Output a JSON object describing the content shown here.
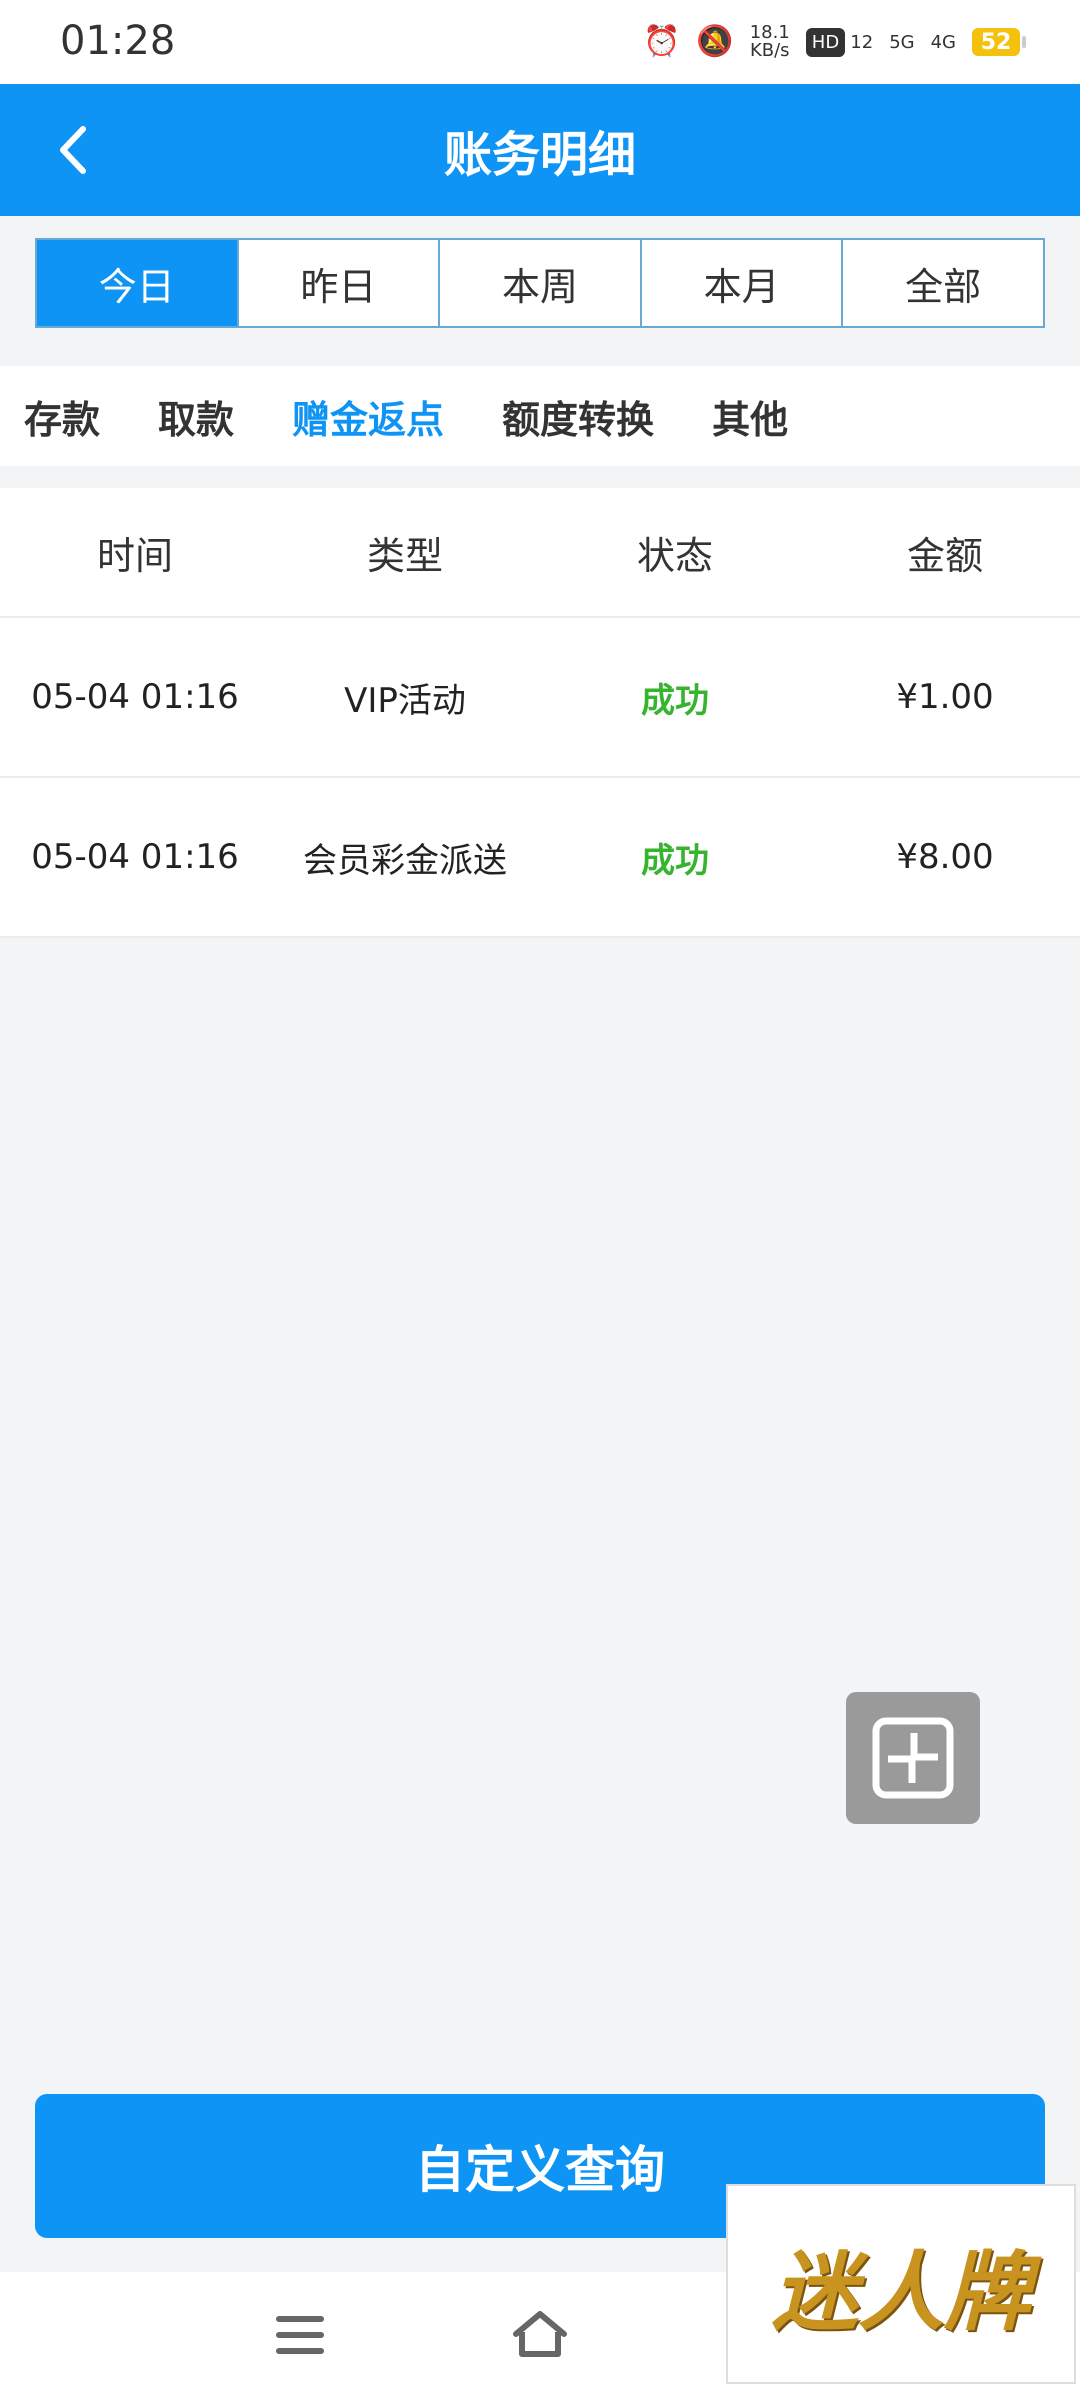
{
  "status_bar": {
    "time": "01:28",
    "net_speed_value": "18.1",
    "net_speed_unit": "KB/s",
    "hd_label": "HD",
    "sim1": "1",
    "sim2": "2",
    "sig_5g": "5G",
    "sig_4g": "4G",
    "battery": "52"
  },
  "header": {
    "title": "账务明细"
  },
  "date_tabs": [
    "今日",
    "昨日",
    "本周",
    "本月",
    "全部"
  ],
  "date_tabs_active": 0,
  "categories": [
    "存款",
    "取款",
    "赠金返点",
    "额度转换",
    "其他"
  ],
  "categories_active": 2,
  "table": {
    "headers": [
      "时间",
      "类型",
      "状态",
      "金额"
    ],
    "rows": [
      {
        "time": "05-04 01:16",
        "type": "VIP活动",
        "status": "成功",
        "amount": "¥1.00"
      },
      {
        "time": "05-04 01:16",
        "type": "会员彩金派送",
        "status": "成功",
        "amount": "¥8.00"
      }
    ]
  },
  "buttons": {
    "custom_query": "自定义查询"
  },
  "watermark": {
    "text": "迷人牌"
  },
  "colors": {
    "accent": "#0e94f5",
    "success": "#35b52e",
    "background": "#f3f4f6"
  }
}
